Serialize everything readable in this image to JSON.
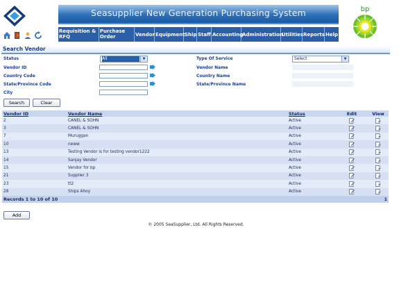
{
  "header": {
    "title": "Seasupplier New Generation Purchasing System",
    "brand_text": "bp"
  },
  "nav": [
    {
      "label": "Requisition & RFQ"
    },
    {
      "label": "Purchase Order"
    },
    {
      "label": "Vendor"
    },
    {
      "label": "Equipment"
    },
    {
      "label": "Ship"
    },
    {
      "label": "Staff"
    },
    {
      "label": "Accounting"
    },
    {
      "label": "Administration"
    },
    {
      "label": "Utilities"
    },
    {
      "label": "Reports"
    },
    {
      "label": "Help"
    }
  ],
  "search": {
    "title": "Search Vendor",
    "status_label": "Status",
    "status_value": "All",
    "vendor_id_label": "Vendor ID",
    "country_code_label": "Country Code",
    "state_code_label": "State/Province Code",
    "city_label": "City",
    "type_label": "Type Of Service",
    "type_value": "Select",
    "vendor_name_label": "Vendor Name",
    "country_name_label": "Country Name",
    "state_name_label": "State/Province Name",
    "search_button": "Search",
    "clear_button": "Clear"
  },
  "table": {
    "columns": [
      "Vendor ID",
      "Vendor Name",
      "Status",
      "Edit",
      "View"
    ],
    "rows": [
      {
        "id": "2",
        "name": "CANEL & SOHN",
        "status": "Active"
      },
      {
        "id": "3",
        "name": "CANEL & SOHN",
        "status": "Active"
      },
      {
        "id": "7",
        "name": "Muruggan",
        "status": "Active"
      },
      {
        "id": "10",
        "name": "neww",
        "status": "Active"
      },
      {
        "id": "13",
        "name": "Testing Vendor is for testing vendor1222",
        "status": "Active"
      },
      {
        "id": "14",
        "name": "Sanjay Vendor",
        "status": "Active"
      },
      {
        "id": "15",
        "name": "Vendor for bp",
        "status": "Active"
      },
      {
        "id": "21",
        "name": "Supplier 3",
        "status": "Active"
      },
      {
        "id": "23",
        "name": "tt2",
        "status": "Active"
      },
      {
        "id": "28",
        "name": "Ships Ahoy",
        "status": "Active"
      }
    ],
    "records_text": "Records 1 to 10 of 10",
    "page": "1"
  },
  "add_button": "Add",
  "footer": "© 2005 SeaSupplier, Ltd. All Rights Reserved.",
  "colors": {
    "banner": "#2d6fb8",
    "nav": "#2a5fa8",
    "header_row": "#c8d6f0",
    "row": "#e4ebf8"
  },
  "icons": [
    "home-icon",
    "exit-door-icon",
    "user-icon",
    "refresh-icon",
    "go-arrow-icon",
    "edit-icon",
    "view-icon"
  ]
}
